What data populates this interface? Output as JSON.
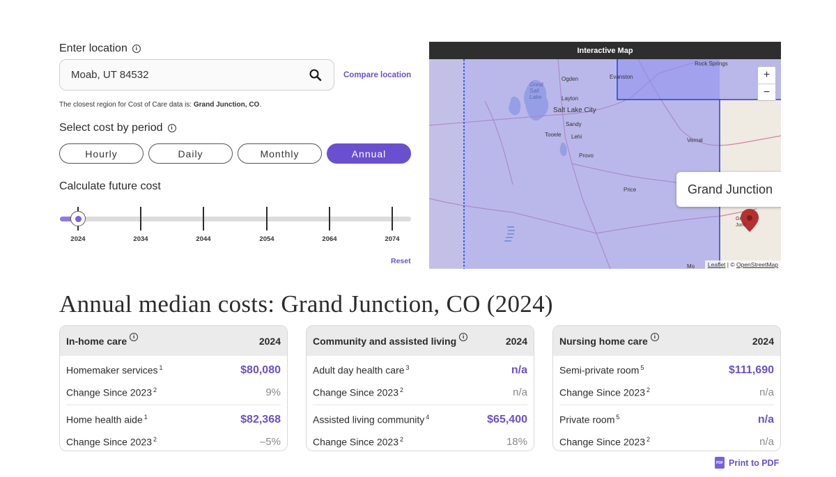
{
  "location": {
    "label": "Enter location",
    "value": "Moab, UT 84532",
    "compare_label": "Compare location",
    "closest_prefix": "The closest region for Cost of Care data is: ",
    "closest_region": "Grand Junction, CO",
    "closest_suffix": "."
  },
  "period": {
    "label": "Select cost by period",
    "options": [
      "Hourly",
      "Daily",
      "Monthly",
      "Annual"
    ],
    "selected": "Annual"
  },
  "future": {
    "label": "Calculate future cost",
    "years": [
      "2024",
      "2034",
      "2044",
      "2054",
      "2064",
      "2074"
    ],
    "selected_year": "2024",
    "reset_label": "Reset"
  },
  "map": {
    "header": "Interactive Map",
    "popup": "Grand Junction",
    "zoom_in": "+",
    "zoom_out": "−",
    "attribution_leaflet": "Leaflet",
    "attribution_sep": " | © ",
    "attribution_osm": "OpenStreetMap",
    "places": [
      "Rock Springs",
      "Ogden",
      "Evanston",
      "Great Salt Lake",
      "Layton",
      "Salt Lake City",
      "Sandy",
      "Tooele",
      "Lehi",
      "Provo",
      "Vernal",
      "Price",
      "Gr Junc",
      "Mo"
    ]
  },
  "results": {
    "title": "Annual median costs: Grand Junction, CO (2024)",
    "cards": [
      {
        "title": "In-home care",
        "year": "2024",
        "items": [
          {
            "label": "Homemaker services",
            "note": "1",
            "value": "$80,080",
            "change_label": "Change Since 2023",
            "change_note": "2",
            "change": "9%"
          },
          {
            "label": "Home health aide",
            "note": "1",
            "value": "$82,368",
            "change_label": "Change Since 2023",
            "change_note": "2",
            "change": "–5%"
          }
        ]
      },
      {
        "title": "Community and assisted living",
        "year": "2024",
        "items": [
          {
            "label": "Adult day health care",
            "note": "3",
            "value": "n/a",
            "change_label": "Change Since 2023",
            "change_note": "2",
            "change": "n/a"
          },
          {
            "label": "Assisted living community",
            "note": "4",
            "value": "$65,400",
            "change_label": "Change Since 2023",
            "change_note": "2",
            "change": "18%"
          }
        ]
      },
      {
        "title": "Nursing home care",
        "year": "2024",
        "items": [
          {
            "label": "Semi-private room",
            "note": "5",
            "value": "$111,690",
            "change_label": "Change Since 2023",
            "change_note": "2",
            "change": "n/a"
          },
          {
            "label": "Private room",
            "note": "5",
            "value": "n/a",
            "change_label": "Change Since 2023",
            "change_note": "2",
            "change": "n/a"
          }
        ]
      }
    ]
  },
  "print": {
    "label": "Print to PDF",
    "icon_text": "PDF"
  },
  "colors": {
    "accent": "#6b4fd1",
    "map_overlay": "#8e8ef0",
    "map_border": "#1f3fe0"
  }
}
